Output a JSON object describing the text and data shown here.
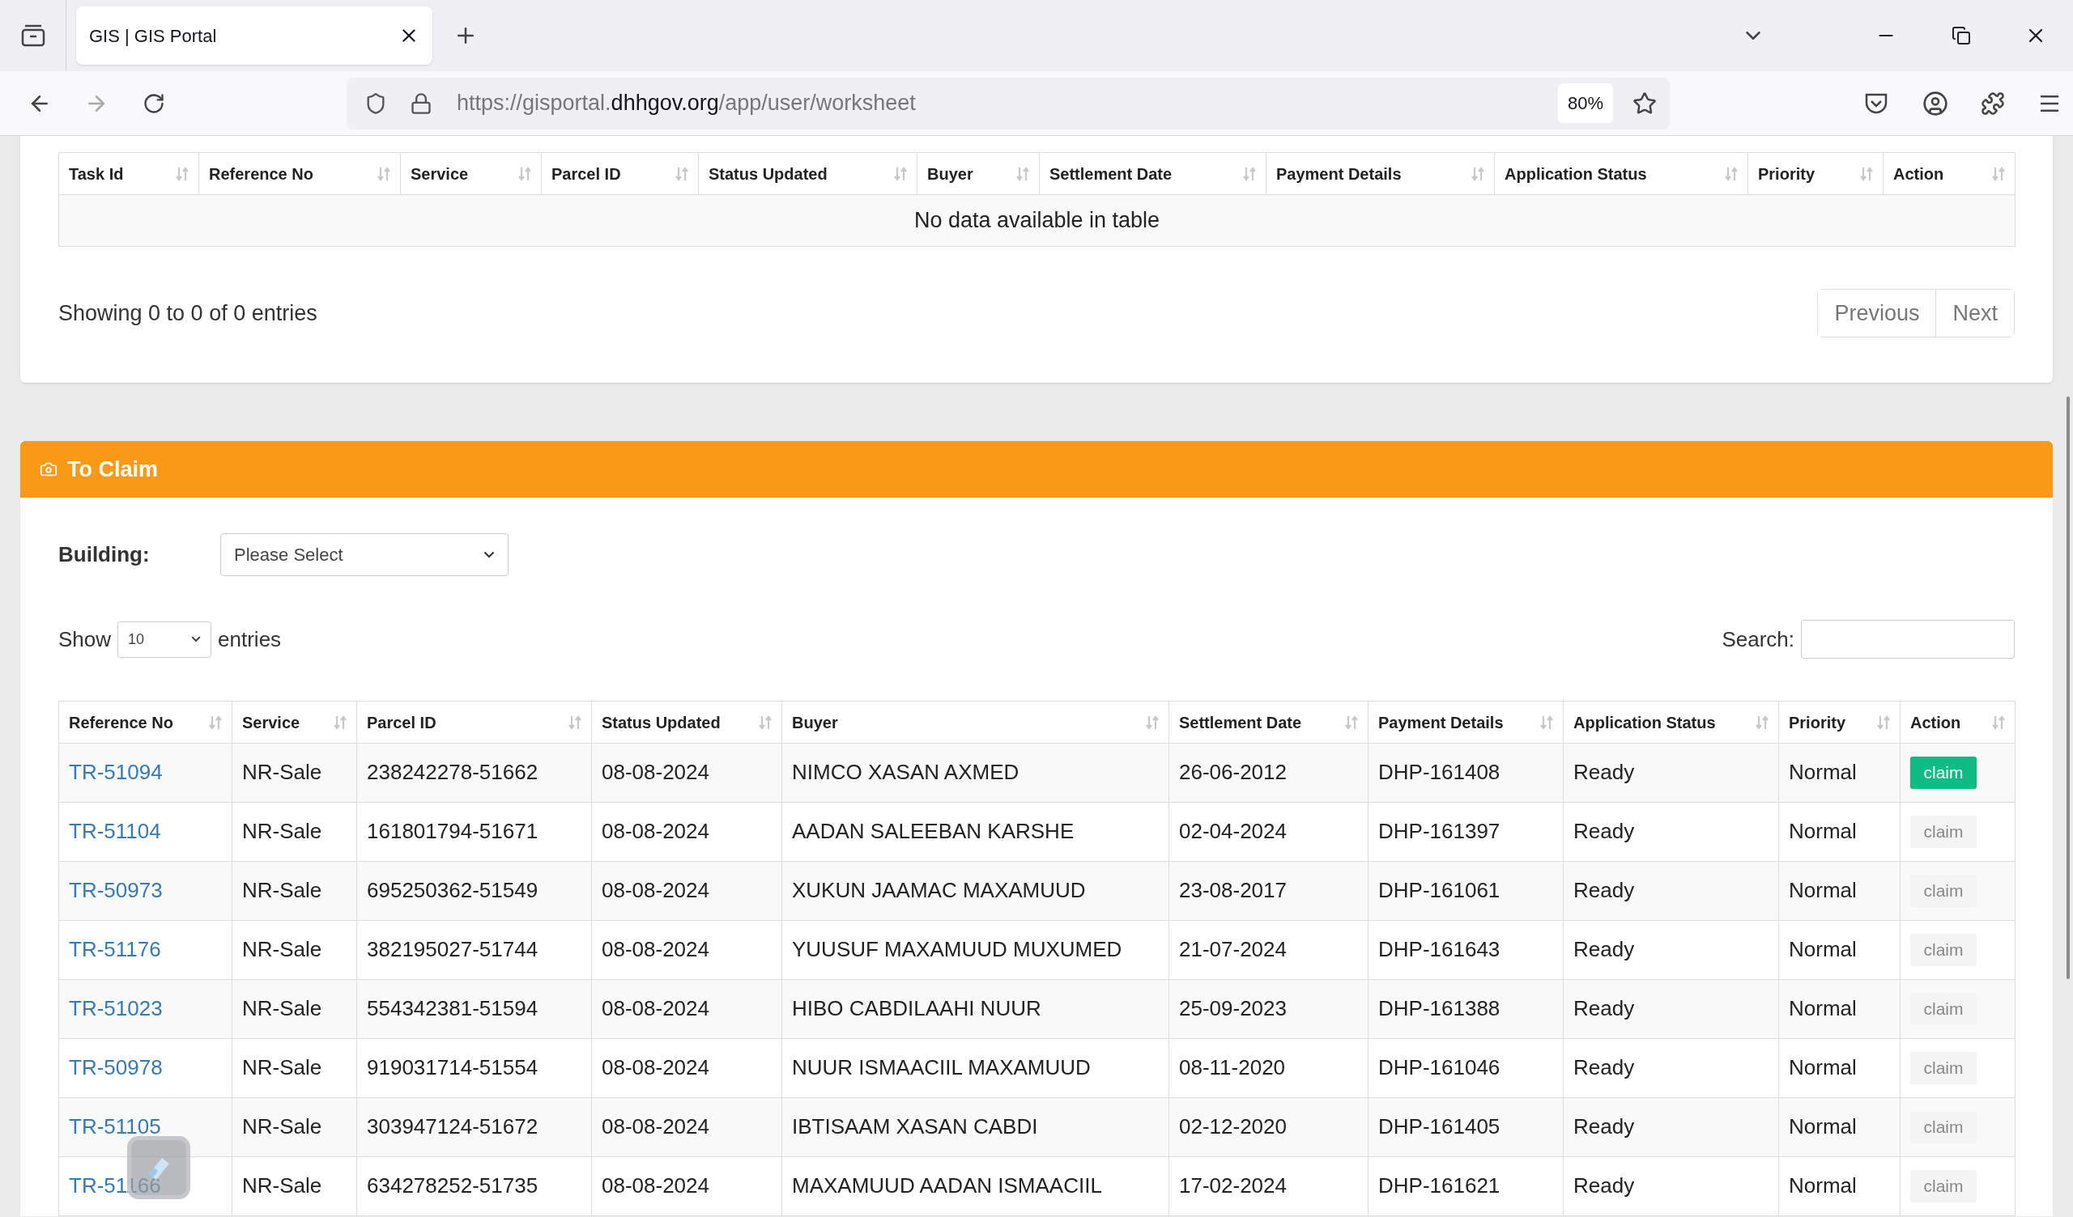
{
  "browser": {
    "tab_title": "GIS | GIS Portal",
    "url_host_prefix": "https://gisportal.",
    "url_domain": "dhhgov.org",
    "url_path": "/app/user/worksheet",
    "zoom": "80%"
  },
  "worksheet": {
    "columns": [
      "Task Id",
      "Reference No",
      "Service",
      "Parcel ID",
      "Status Updated",
      "Buyer",
      "Settlement Date",
      "Payment Details",
      "Application Status",
      "Priority",
      "Action"
    ],
    "empty_message": "No data available in table",
    "info": "Showing 0 to 0 of 0 entries",
    "pagination": [
      "Previous",
      "Next"
    ]
  },
  "to_claim": {
    "title": "To Claim",
    "building_label": "Building:",
    "building_select": "Please Select",
    "show_label": "Show",
    "page_size": "10",
    "entries_label": "entries",
    "search_label": "Search:",
    "columns": [
      "Reference No",
      "Service",
      "Parcel ID",
      "Status Updated",
      "Buyer",
      "Settlement Date",
      "Payment Details",
      "Application Status",
      "Priority",
      "Action"
    ],
    "rows": [
      {
        "ref": "TR-51094",
        "service": "NR-Sale",
        "parcel": "238242278-51662",
        "updated": "08-08-2024",
        "buyer": "NIMCO XASAN AXMED",
        "settlement": "26-06-2012",
        "payment": "DHP-161408",
        "status": "Ready",
        "priority": "Normal",
        "action": "claim",
        "highlighted": true
      },
      {
        "ref": "TR-51104",
        "service": "NR-Sale",
        "parcel": "161801794-51671",
        "updated": "08-08-2024",
        "buyer": "AADAN SALEEBAN KARSHE",
        "settlement": "02-04-2024",
        "payment": "DHP-161397",
        "status": "Ready",
        "priority": "Normal",
        "action": "claim",
        "highlighted": false
      },
      {
        "ref": "TR-50973",
        "service": "NR-Sale",
        "parcel": "695250362-51549",
        "updated": "08-08-2024",
        "buyer": "XUKUN JAAMAC MAXAMUUD",
        "settlement": "23-08-2017",
        "payment": "DHP-161061",
        "status": "Ready",
        "priority": "Normal",
        "action": "claim",
        "highlighted": false
      },
      {
        "ref": "TR-51176",
        "service": "NR-Sale",
        "parcel": "382195027-51744",
        "updated": "08-08-2024",
        "buyer": "YUUSUF MAXAMUUD MUXUMED",
        "settlement": "21-07-2024",
        "payment": "DHP-161643",
        "status": "Ready",
        "priority": "Normal",
        "action": "claim",
        "highlighted": false
      },
      {
        "ref": "TR-51023",
        "service": "NR-Sale",
        "parcel": "554342381-51594",
        "updated": "08-08-2024",
        "buyer": "HIBO CABDILAAHI NUUR",
        "settlement": "25-09-2023",
        "payment": "DHP-161388",
        "status": "Ready",
        "priority": "Normal",
        "action": "claim",
        "highlighted": false
      },
      {
        "ref": "TR-50978",
        "service": "NR-Sale",
        "parcel": "919031714-51554",
        "updated": "08-08-2024",
        "buyer": "NUUR ISMAACIIL MAXAMUUD",
        "settlement": "08-11-2020",
        "payment": "DHP-161046",
        "status": "Ready",
        "priority": "Normal",
        "action": "claim",
        "highlighted": false
      },
      {
        "ref": "TR-51105",
        "service": "NR-Sale",
        "parcel": "303947124-51672",
        "updated": "08-08-2024",
        "buyer": "IBTISAAM XASAN CABDI",
        "settlement": "02-12-2020",
        "payment": "DHP-161405",
        "status": "Ready",
        "priority": "Normal",
        "action": "claim",
        "highlighted": false
      },
      {
        "ref": "TR-51166",
        "service": "NR-Sale",
        "parcel": "634278252-51735",
        "updated": "08-08-2024",
        "buyer": "MAXAMUUD AADAN ISMAACIIL",
        "settlement": "17-02-2024",
        "payment": "DHP-161621",
        "status": "Ready",
        "priority": "Normal",
        "action": "claim",
        "highlighted": false
      }
    ]
  }
}
